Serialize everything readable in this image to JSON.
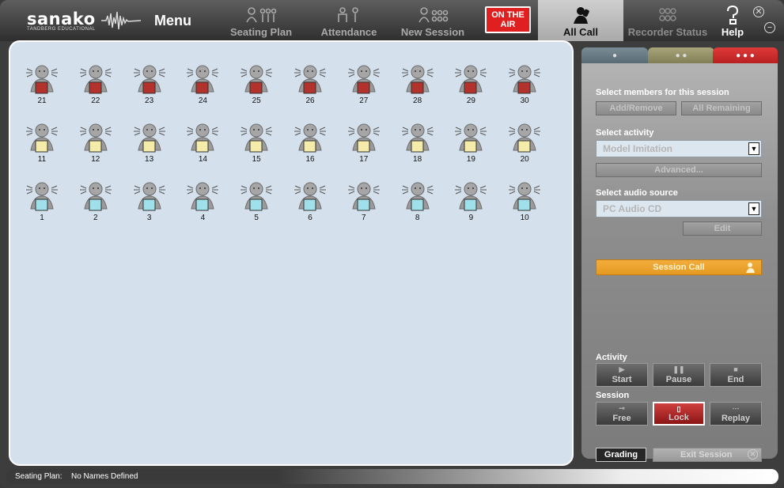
{
  "app": {
    "logo_text": "sanako",
    "logo_subtext": "TANDBERG EDUCATIONAL",
    "menu_label": "Menu"
  },
  "tabs": [
    {
      "label": "Seating Plan",
      "icon": "seating-plan-icon",
      "active": false
    },
    {
      "label": "Attendance",
      "icon": "attendance-icon",
      "active": false
    },
    {
      "label": "New Session",
      "icon": "new-session-icon",
      "active": false
    },
    {
      "label": "All Call",
      "icon": "all-call-icon",
      "active": true
    },
    {
      "label": "Recorder Status",
      "icon": "recorder-status-icon",
      "active": false
    }
  ],
  "on_air": {
    "line1": "ON THE",
    "line2": "AIR"
  },
  "help": {
    "label": "Help"
  },
  "window_buttons": {
    "close": "close-icon",
    "minimize": "minimize-icon"
  },
  "colors": {
    "group_red": "#b3322c",
    "group_yellow": "#f5ecaa",
    "group_cyan": "#9fe0ea",
    "accent_orange": "#f0a830",
    "panel_tab_blue": "#5e7480",
    "panel_tab_olive": "#8b8760",
    "panel_tab_red": "#cc2525"
  },
  "students": [
    {
      "rows": [
        "21",
        "22",
        "23",
        "24",
        "25",
        "26",
        "27",
        "28",
        "29",
        "30"
      ],
      "color": "#b3322c"
    },
    {
      "rows": [
        "11",
        "12",
        "13",
        "14",
        "15",
        "16",
        "17",
        "18",
        "19",
        "20"
      ],
      "color": "#f5ecaa"
    },
    {
      "rows": [
        "1",
        "2",
        "3",
        "4",
        "5",
        "6",
        "7",
        "8",
        "9",
        "10"
      ],
      "color": "#9fe0ea"
    }
  ],
  "panel": {
    "tabs": [
      "●",
      "● ●",
      "● ● ●"
    ],
    "members_title": "Select members for this session",
    "add_remove": "Add/Remove",
    "all_remaining": "All Remaining",
    "activity_title": "Select activity",
    "activity_value": "Model Imitation",
    "advanced": "Advanced...",
    "audio_title": "Select audio source",
    "audio_value": "PC Audio CD",
    "edit": "Edit",
    "session_call": "Session Call",
    "activity_label": "Activity",
    "start": "Start",
    "pause": "Pause",
    "end": "End",
    "session_label": "Session",
    "free": "Free",
    "lock": "Lock",
    "replay": "Replay",
    "grading": "Grading",
    "exit_session": "Exit Session"
  },
  "status": {
    "label": "Seating Plan:",
    "value": "No Names Defined"
  }
}
